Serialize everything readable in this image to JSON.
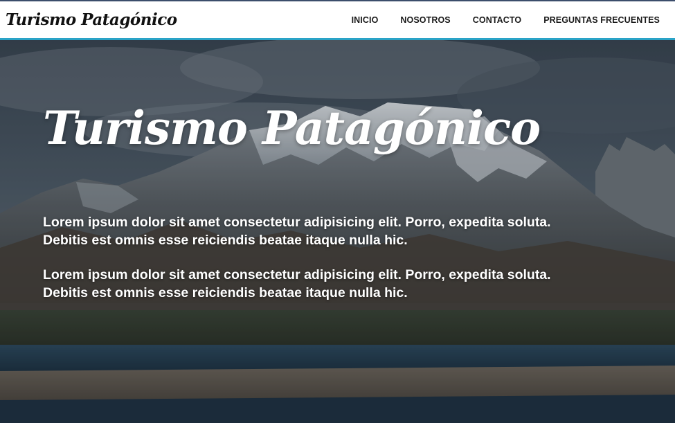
{
  "header": {
    "brand": "Turismo Patagónico",
    "nav": [
      {
        "label": "INICIO"
      },
      {
        "label": "NOSOTROS"
      },
      {
        "label": "CONTACTO"
      },
      {
        "label": "PREGUNTAS FRECUENTES"
      }
    ],
    "accent_color": "#2aa3c7"
  },
  "hero": {
    "title": "Turismo Patagónico",
    "paragraphs": [
      "Lorem ipsum dolor sit amet consectetur adipisicing elit. Porro, expedita soluta. Debitis est omnis esse reiciendis beatae itaque nulla hic.",
      "Lorem ipsum dolor sit amet consectetur adipisicing elit. Porro, expedita soluta. Debitis est omnis esse reiciendis beatae itaque nulla hic."
    ]
  }
}
